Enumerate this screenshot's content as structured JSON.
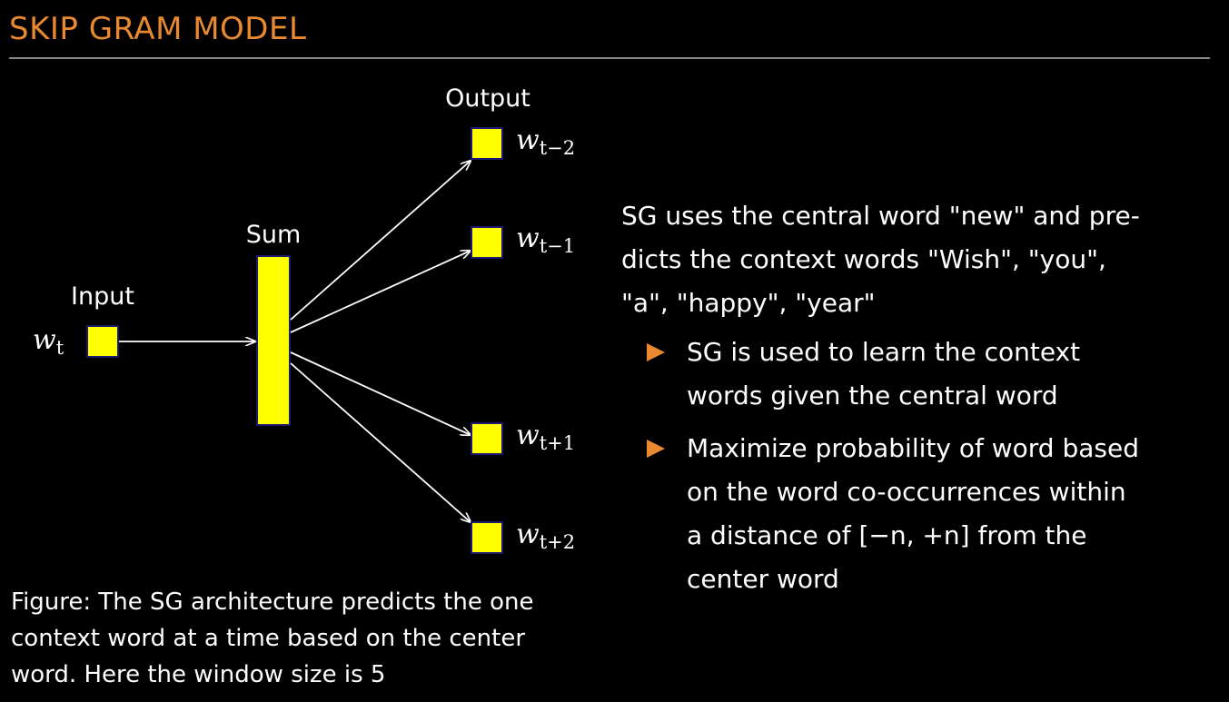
{
  "slide": {
    "title": "SKIP GRAM MODEL",
    "accent_color": "#e8892f",
    "node_fill": "#ffff00",
    "node_border": "#1a1a6e"
  },
  "diagram": {
    "input_label": "Input",
    "sum_label": "Sum",
    "output_label": "Output",
    "input_node": {
      "var": "w",
      "sub": "t"
    },
    "outputs": [
      {
        "var": "w",
        "sub": "t−2"
      },
      {
        "var": "w",
        "sub": "t−1"
      },
      {
        "var": "w",
        "sub": "t+1"
      },
      {
        "var": "w",
        "sub": "t+2"
      }
    ]
  },
  "caption": {
    "lines": [
      "Figure: The SG architecture predicts the one",
      "context word at a time based on the center",
      "word. Here the window size is 5"
    ]
  },
  "description": {
    "lines": [
      "SG uses the central word \"new\" and pre-",
      "dicts the context words \"Wish\", \"you\",",
      "\"a\", \"happy\", \"year\""
    ]
  },
  "bullets": [
    {
      "lines": [
        "SG is used to learn the context",
        "words given the central word"
      ]
    },
    {
      "lines": [
        "Maximize probability of word based",
        "on the word co-occurrences within",
        "a distance of [−n, +n] from the",
        "center word"
      ]
    }
  ]
}
